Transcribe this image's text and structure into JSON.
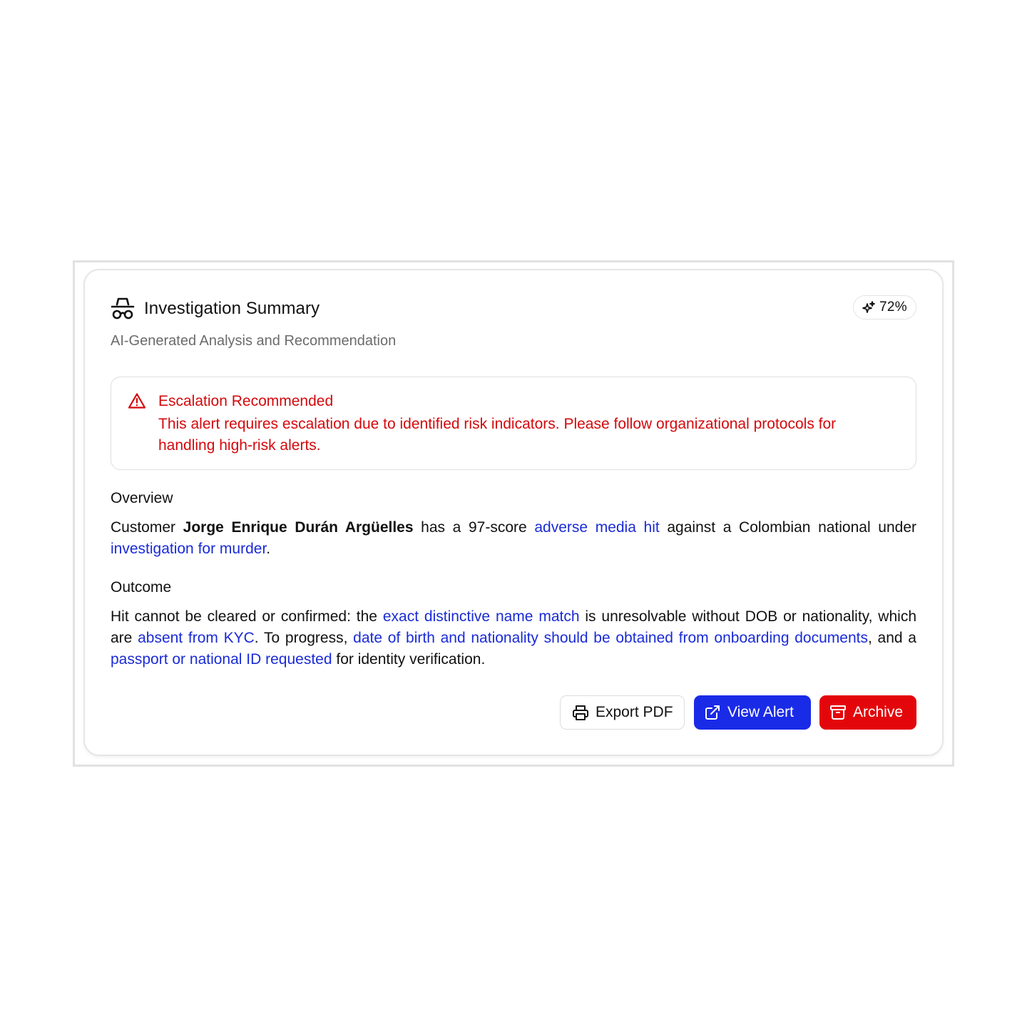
{
  "header": {
    "icon": "incognito-spy-icon",
    "title": "Investigation Summary",
    "subtitle": "AI-Generated Analysis and Recommendation",
    "confidence_icon": "sparkles-icon",
    "confidence": "72%"
  },
  "alert": {
    "icon": "warning-triangle-icon",
    "title": "Escalation Recommended",
    "text": "This alert requires escalation due to identified risk indicators. Please follow organizational protocols for handling high-risk alerts.",
    "color": "#d4090c"
  },
  "overview": {
    "heading": "Overview",
    "p1": "Customer ",
    "name": "Jorge Enrique Durán Argüelles",
    "p2": " has a 97-score ",
    "hl1": "adverse media hit",
    "p3": " against a Colombian national under ",
    "hl2": "investigation for murder",
    "p4": "."
  },
  "outcome": {
    "heading": "Outcome",
    "p1": "Hit cannot be cleared or confirmed: the ",
    "hl1": "exact distinctive name match",
    "p2": " is unresolvable without DOB or nationality, which are ",
    "hl2": "absent from KYC",
    "p3": ". To progress, ",
    "hl3": "date of birth and nationality should be obtained from onboarding documents",
    "p4": ", and a ",
    "hl4": "passport or national ID requested",
    "p5": " for identity verification."
  },
  "actions": {
    "export_label": "Export PDF",
    "export_icon": "printer-icon",
    "view_label": "View Alert",
    "view_icon": "external-link-icon",
    "archive_label": "Archive",
    "archive_icon": "archive-box-icon"
  },
  "colors": {
    "highlight": "#1a2bd6",
    "primary_button": "#1a2be8",
    "danger_button": "#e3070b"
  }
}
